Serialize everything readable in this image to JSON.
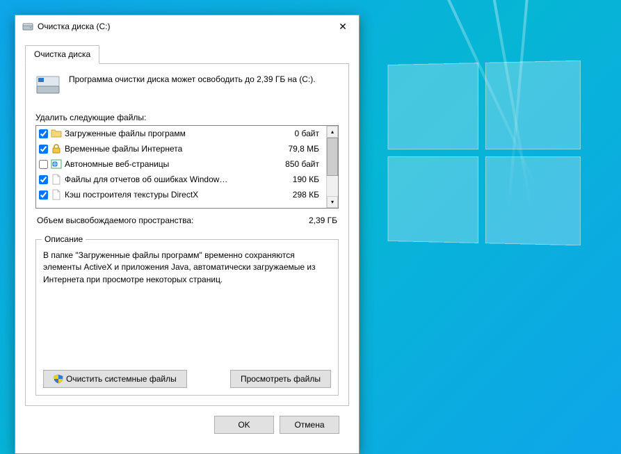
{
  "window": {
    "title": "Очистка диска  (C:)"
  },
  "tabs": {
    "main": "Очистка диска"
  },
  "intro": {
    "text": "Программа очистки диска может освободить до 2,39 ГБ на (C:)."
  },
  "list": {
    "label": "Удалить следующие файлы:",
    "items": [
      {
        "checked": true,
        "icon": "folder",
        "name": "Загруженные файлы программ",
        "size": "0 байт"
      },
      {
        "checked": true,
        "icon": "lock",
        "name": "Временные файлы Интернета",
        "size": "79,8 МБ"
      },
      {
        "checked": false,
        "icon": "globe",
        "name": "Автономные веб-страницы",
        "size": "850 байт"
      },
      {
        "checked": true,
        "icon": "file",
        "name": "Файлы для отчетов об ошибках Window…",
        "size": "190 КБ"
      },
      {
        "checked": true,
        "icon": "file",
        "name": "Кэш построителя текстуры DirectX",
        "size": "298 КБ"
      }
    ]
  },
  "total": {
    "label": "Объем высвобождаемого пространства:",
    "value": "2,39 ГБ"
  },
  "description": {
    "title": "Описание",
    "text": "В папке \"Загруженные файлы программ\" временно сохраняются элементы ActiveX и приложения Java, автоматически загружаемые из Интернета при просмотре некоторых страниц."
  },
  "buttons": {
    "clean_system": "Очистить системные файлы",
    "view_files": "Просмотреть файлы",
    "ok": "OK",
    "cancel": "Отмена"
  }
}
